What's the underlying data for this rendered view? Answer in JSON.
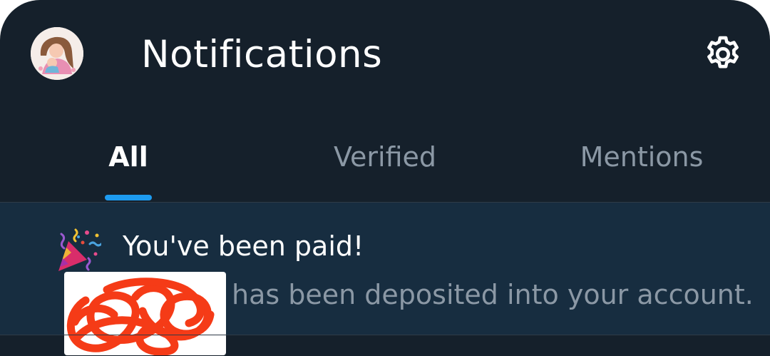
{
  "header": {
    "title": "Notifications",
    "avatar_icon": "profile-avatar-mother-child",
    "settings_icon": "gear-icon"
  },
  "tabs": [
    {
      "label": "All",
      "active": true
    },
    {
      "label": "Verified",
      "active": false
    },
    {
      "label": "Mentions",
      "active": false
    }
  ],
  "notification": {
    "icon": "party-popper-icon",
    "title": "You've been paid!",
    "body": "has been deposited into your account."
  },
  "colors": {
    "background": "#15202b",
    "notification_background": "#172d40",
    "accent": "#1d9bf0",
    "muted_text": "#8b98a5",
    "redaction_scribble": "#f53b17"
  }
}
